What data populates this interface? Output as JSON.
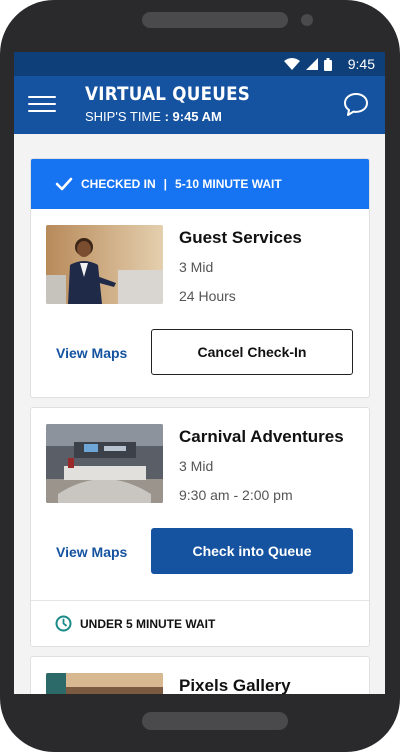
{
  "status_bar": {
    "time": "9:45"
  },
  "app_bar": {
    "title": "VIRTUAL QUEUES",
    "ship_time_label": "SHIP'S TIME",
    "ship_time_value": "9:45 AM"
  },
  "queues": [
    {
      "banner": {
        "status": "CHECKED IN",
        "wait": "5-10 MINUTE WAIT"
      },
      "name": "Guest Services",
      "deck": "3 Mid",
      "hours": "24 Hours",
      "view_maps_label": "View Maps",
      "action_label": "Cancel Check-In"
    },
    {
      "name": "Carnival Adventures",
      "deck": "3 Mid",
      "hours": "9:30 am - 2:00 pm",
      "view_maps_label": "View Maps",
      "action_label": "Check into Queue",
      "wait_text": "UNDER 5 MINUTE WAIT"
    },
    {
      "name": "Pixels Gallery"
    }
  ],
  "colors": {
    "header": "#1553a0",
    "status_bar": "#0f3f78",
    "banner": "#1673f2",
    "link": "#1553a0",
    "clock_icon": "#1a8a8a"
  }
}
